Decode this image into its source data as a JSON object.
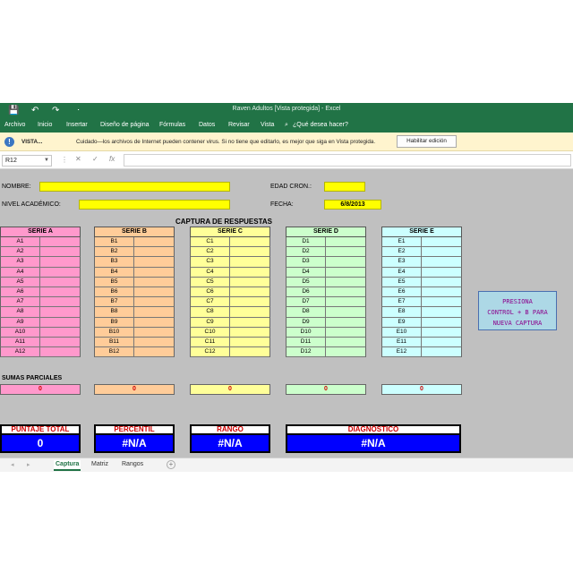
{
  "window": {
    "title": "Raven Adultos  [Vista protegida] - Excel",
    "save_icon": "💾",
    "undo_icon": "↶",
    "redo_icon": "↷",
    "qa_more": "⋅"
  },
  "ribbon": {
    "tabs": [
      "Archivo",
      "Inicio",
      "Insertar",
      "Diseño de página",
      "Fórmulas",
      "Datos",
      "Revisar",
      "Vista"
    ],
    "tellme_icon": "⌕",
    "tellme": "¿Qué desea hacer?"
  },
  "protected_view": {
    "label": "VISTA...",
    "message": "Cuidado—los archivos de Internet pueden contener virus. Si no tiene que editarlo, es mejor que siga en Vista protegida.",
    "button": "Habilitar edición"
  },
  "formula_bar": {
    "cell": "R12",
    "cancel_icon": "✕",
    "enter_icon": "✓",
    "fx": "fx",
    "value": ""
  },
  "form": {
    "nombre_label": "NOMBRE:",
    "nombre_value": "",
    "nivel_label": "NIVEL ACADÉMICO:",
    "nivel_value": "",
    "edad_label": "EDAD CRON.:",
    "edad_value": "",
    "fecha_label": "FECHA:",
    "fecha_value": "6/8/2013"
  },
  "captura_title": "CAPTURA DE RESPUESTAS",
  "series": [
    {
      "name": "SERIE A",
      "color": "#ff99cc",
      "items": [
        "A1",
        "A2",
        "A3",
        "A4",
        "A5",
        "A6",
        "A7",
        "A8",
        "A9",
        "A10",
        "A11",
        "A12"
      ]
    },
    {
      "name": "SERIE B",
      "color": "#ffcc99",
      "items": [
        "B1",
        "B2",
        "B3",
        "B4",
        "B5",
        "B6",
        "B7",
        "B8",
        "B9",
        "B10",
        "B11",
        "B12"
      ]
    },
    {
      "name": "SERIE C",
      "color": "#ffff99",
      "items": [
        "C1",
        "C2",
        "C3",
        "C4",
        "C5",
        "C6",
        "C7",
        "C8",
        "C9",
        "C10",
        "C11",
        "C12"
      ]
    },
    {
      "name": "SERIE D",
      "color": "#ccffcc",
      "items": [
        "D1",
        "D2",
        "D3",
        "D4",
        "D5",
        "D6",
        "D7",
        "D8",
        "D9",
        "D10",
        "D11",
        "D12"
      ]
    },
    {
      "name": "SERIE E",
      "color": "#ccffff",
      "items": [
        "E1",
        "E2",
        "E3",
        "E4",
        "E5",
        "E6",
        "E7",
        "E8",
        "E9",
        "E10",
        "E11",
        "E12"
      ]
    }
  ],
  "sumas_label": "SUMAS PARCIALES",
  "sumas": [
    "0",
    "0",
    "0",
    "0",
    "0"
  ],
  "results": [
    {
      "label": "PUNTAJE TOTAL",
      "value": "0"
    },
    {
      "label": "PERCENTIL",
      "value": "#N/A"
    },
    {
      "label": "RANGO",
      "value": "#N/A"
    },
    {
      "label": "DIAGNÓSTICO",
      "value": "#N/A"
    }
  ],
  "presiona_lines": [
    "PRESIONA",
    "CONTROL + B PARA",
    "NUEVA CAPTURA"
  ],
  "sheet_tabs": [
    "Captura",
    "Matriz",
    "Rangos"
  ],
  "sheet_nav": {
    "prev": "◂",
    "next": "▸",
    "add": "+"
  }
}
